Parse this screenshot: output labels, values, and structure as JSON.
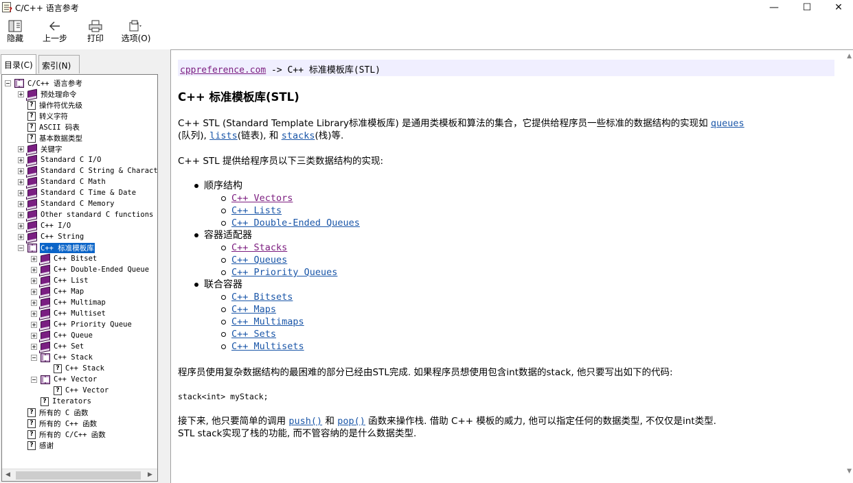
{
  "window": {
    "title": "C/C++ 语言参考",
    "icon": "help-book-icon",
    "controls": {
      "minimize": "—",
      "maximize": "☐",
      "close": "✕"
    }
  },
  "toolbar": {
    "hide_label": "隐藏",
    "back_label": "上一步",
    "print_label": "打印",
    "options_label": "选项(O)"
  },
  "tabs": {
    "contents_label": "目录(C)",
    "index_label": "索引(N)"
  },
  "tree": {
    "root": "C/C++ 语言参考",
    "items": [
      "预处理命令",
      "操作符优先级",
      "转义字符",
      "ASCII 码表",
      "基本数据类型",
      "关键字",
      "Standard C I/O",
      "Standard C String & Character",
      "Standard C Math",
      "Standard C Time & Date",
      "Standard C Memory",
      "Other standard C functions",
      "C++ I/O",
      "C++ String",
      "C++ 标准模板库"
    ],
    "stl_children": [
      "C++ Bitset",
      "C++ Double-Ended Queue",
      "C++ List",
      "C++ Map",
      "C++ Multimap",
      "C++ Multiset",
      "C++ Priority Queue",
      "C++ Queue",
      "C++ Set",
      "C++ Stack"
    ],
    "stack_child": "C++ Stack",
    "vector": "C++ Vector",
    "vector_child": "C++ Vector",
    "iterators": "Iterators",
    "tail": [
      "所有的 C 函数",
      "所有的 C++ 函数",
      "所有的 C/C++ 函数",
      "感谢"
    ]
  },
  "content": {
    "breadcrumb_link": "cppreference.com",
    "breadcrumb_rest": " -> C++ 标准模板库(STL)",
    "heading": "C++ 标准模板库(STL)",
    "intro_a": "C++ STL (Standard Template Library标准模板库) 是通用类模板和算法的集合，它提供给程序员一些标准的数据结构的实现如 ",
    "intro_link1": "queues",
    "intro_b": "(队列), ",
    "intro_link2": "lists",
    "intro_c": "(链表), 和 ",
    "intro_link3": "stacks",
    "intro_d": "(栈)等.",
    "lead": "C++ STL 提供给程序员以下三类数据结构的实现:",
    "groups": [
      {
        "name": "顺序结构",
        "links": [
          "C++ Vectors",
          "C++ Lists",
          "C++ Double-Ended Queues"
        ]
      },
      {
        "name": "容器适配器",
        "links": [
          "C++ Stacks",
          "C++ Queues",
          "C++ Priority Queues"
        ]
      },
      {
        "name": "联合容器",
        "links": [
          "C++ Bitsets",
          "C++ Maps",
          "C++ Multimaps",
          "C++ Sets",
          "C++ Multisets"
        ]
      }
    ],
    "para2": "程序员使用复杂数据结构的最困难的部分已经由STL完成. 如果程序员想使用包含int数据的stack, 他只要写出如下的代码:",
    "code": "stack<int> myStack;",
    "para3_a": "接下来, 他只要简单的调用 ",
    "push_link": "push()",
    "para3_b": " 和 ",
    "pop_link": "pop()",
    "para3_c": " 函数来操作栈. 借助 C++ 模板的威力, 他可以指定任何的数据类型, 不仅仅是int类型.",
    "para3_line2": "STL stack实现了栈的功能, 而不管容纳的是什么数据类型."
  },
  "colors": {
    "link": "#1a56a8",
    "visited_link": "#7b1c7f",
    "selection": "#0a64c8",
    "breadcrumb_bg": "#f0efff",
    "book": "#7a1f82"
  }
}
